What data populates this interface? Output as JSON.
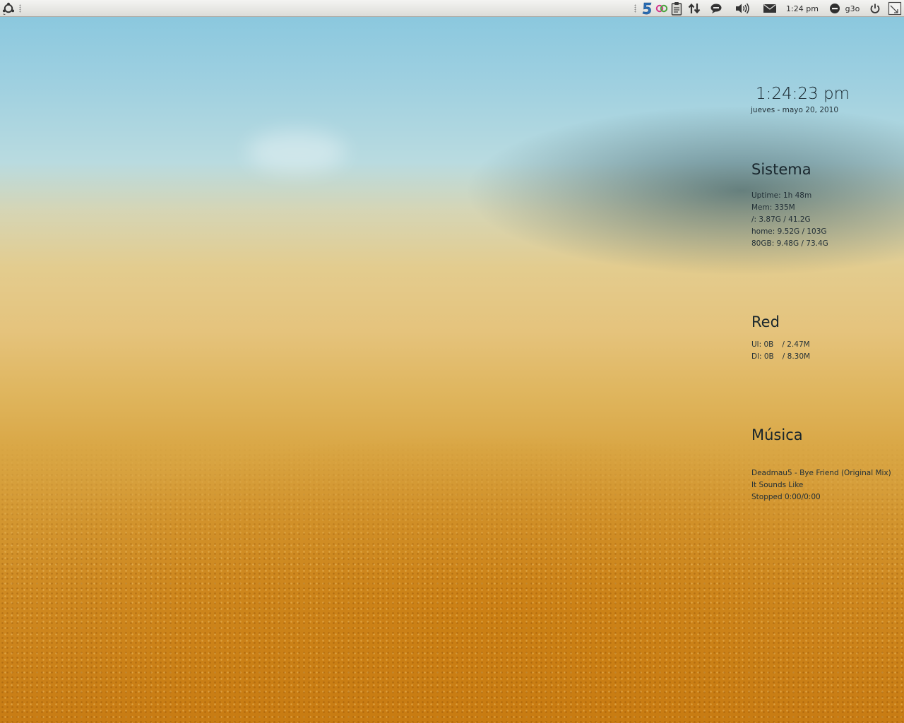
{
  "panel": {
    "clock": "1:24 pm",
    "user": "g3o"
  },
  "tray": {
    "icons": [
      "main-menu-icon",
      "app-icon-5",
      "network-apps-icon",
      "clipboard-icon",
      "transfer-arrows-icon",
      "chat-icon",
      "volume-icon",
      "mail-icon",
      "user-status-icon",
      "power-icon",
      "show-desktop-icon"
    ]
  },
  "conky": {
    "time": "1:24:23 pm",
    "date": "jueves - mayo 20, 2010",
    "system": {
      "title": "Sistema",
      "uptime": "Uptime: 1h 48m",
      "mem": "Mem: 335M",
      "root": "/: 3.87G / 41.2G",
      "home": "home: 9.52G / 103G",
      "disk80": "80GB: 9.48G / 73.4G"
    },
    "network": {
      "title": "Red",
      "upload": "Ul: 0B",
      "upload_total": "/ 2.47M",
      "download": "Dl: 0B",
      "download_total": "/ 8.30M"
    },
    "music": {
      "title": "Música",
      "track": "Deadmau5 - Bye Friend (Original Mix)",
      "album": "It Sounds Like",
      "status": "Stopped 0:00/0:00"
    }
  }
}
